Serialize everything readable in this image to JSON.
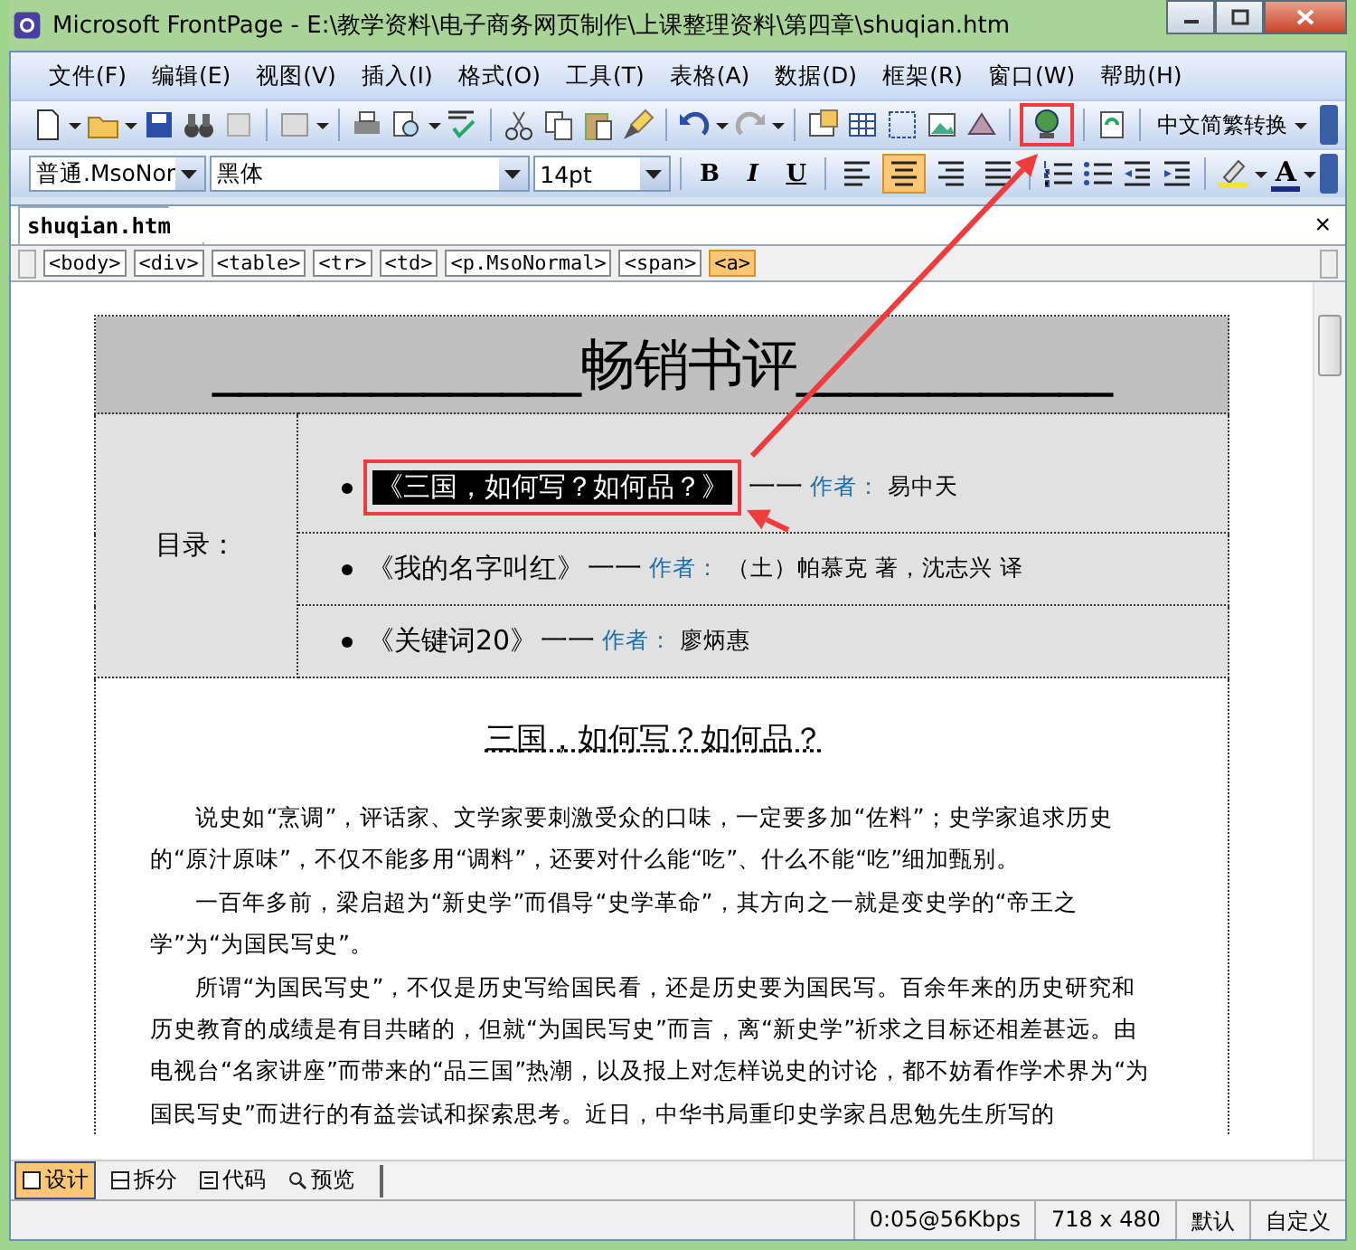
{
  "window": {
    "title": "Microsoft FrontPage - E:\\教学资料\\电子商务网页制作\\上课整理资料\\第四章\\shuqian.htm"
  },
  "menu": [
    "文件(F)",
    "编辑(E)",
    "视图(V)",
    "插入(I)",
    "格式(O)",
    "工具(T)",
    "表格(A)",
    "数据(D)",
    "框架(R)",
    "窗口(W)",
    "帮助(H)"
  ],
  "toolbar": {
    "convert_button": "中文简繁转换"
  },
  "format_bar": {
    "style": "普通.MsoNor",
    "font": "黑体",
    "size": "14pt",
    "bold": "B",
    "italic": "I",
    "underline": "U",
    "align_buttons": [
      {
        "selected": false
      },
      {
        "selected": true
      },
      {
        "selected": false
      },
      {
        "selected": false
      }
    ],
    "font_color": "A"
  },
  "document_tab": {
    "label": "shuqian.htm",
    "close": "×"
  },
  "tag_path": [
    {
      "label": "<body>",
      "selected": false
    },
    {
      "label": "<div>",
      "selected": false
    },
    {
      "label": "<table>",
      "selected": false
    },
    {
      "label": "<tr>",
      "selected": false
    },
    {
      "label": "<td>",
      "selected": false
    },
    {
      "label": "<p.MsoNormal>",
      "selected": false
    },
    {
      "label": "<span>",
      "selected": false
    },
    {
      "label": "<a>",
      "selected": true
    }
  ],
  "page": {
    "banner": "______________畅销书评____________",
    "toc_label": "目录：",
    "toc": [
      {
        "title": "《三国，如何写？如何品？》",
        "dash": "一一",
        "author_label": "作者：",
        "author": "易中天",
        "selected": true
      },
      {
        "title": "《我的名字叫红》",
        "dash": "一一",
        "author_label": "作者：",
        "author": "（土）帕慕克 著，沈志兴 译",
        "selected": false
      },
      {
        "title": "《关键词20》",
        "dash": "一一",
        "author_label": "作者：",
        "author": "廖炳惠",
        "selected": false
      }
    ],
    "article_title": "三国，如何写？如何品？",
    "paragraphs": [
      "说史如“烹调”，评话家、文学家要刺激受众的口味，一定要多加“佐料”；史学家追求历史的“原汁原味”，不仅不能多用“调料”，还要对什么能“吃”、什么不能“吃”细加甄别。",
      "一百年多前，梁启超为“新史学”而倡导“史学革命”，其方向之一就是变史学的“帝王之学”为“为国民写史”。",
      "所谓“为国民写史”，不仅是历史写给国民看，还是历史要为国民写。百余年来的历史研究和历史教育的成绩是有目共睹的，但就“为国民写史”而言，离“新史学”祈求之目标还相差甚远。由电视台“名家讲座”而带来的“品三国”热潮，以及报上对怎样说史的讨论，都不妨看作学术界为“为国民写史”而进行的有益尝试和探索思考。近日，中华书局重印史学家吕思勉先生所写的"
    ]
  },
  "view_tabs": [
    {
      "label": "设计",
      "kind": "design",
      "selected": true
    },
    {
      "label": "拆分",
      "kind": "split",
      "selected": false
    },
    {
      "label": "代码",
      "kind": "code",
      "selected": false
    },
    {
      "label": "预览",
      "kind": "preview",
      "selected": false
    }
  ],
  "status_bar": [
    "0:05@56Kbps",
    "718 x 480",
    "默认",
    "自定义"
  ]
}
